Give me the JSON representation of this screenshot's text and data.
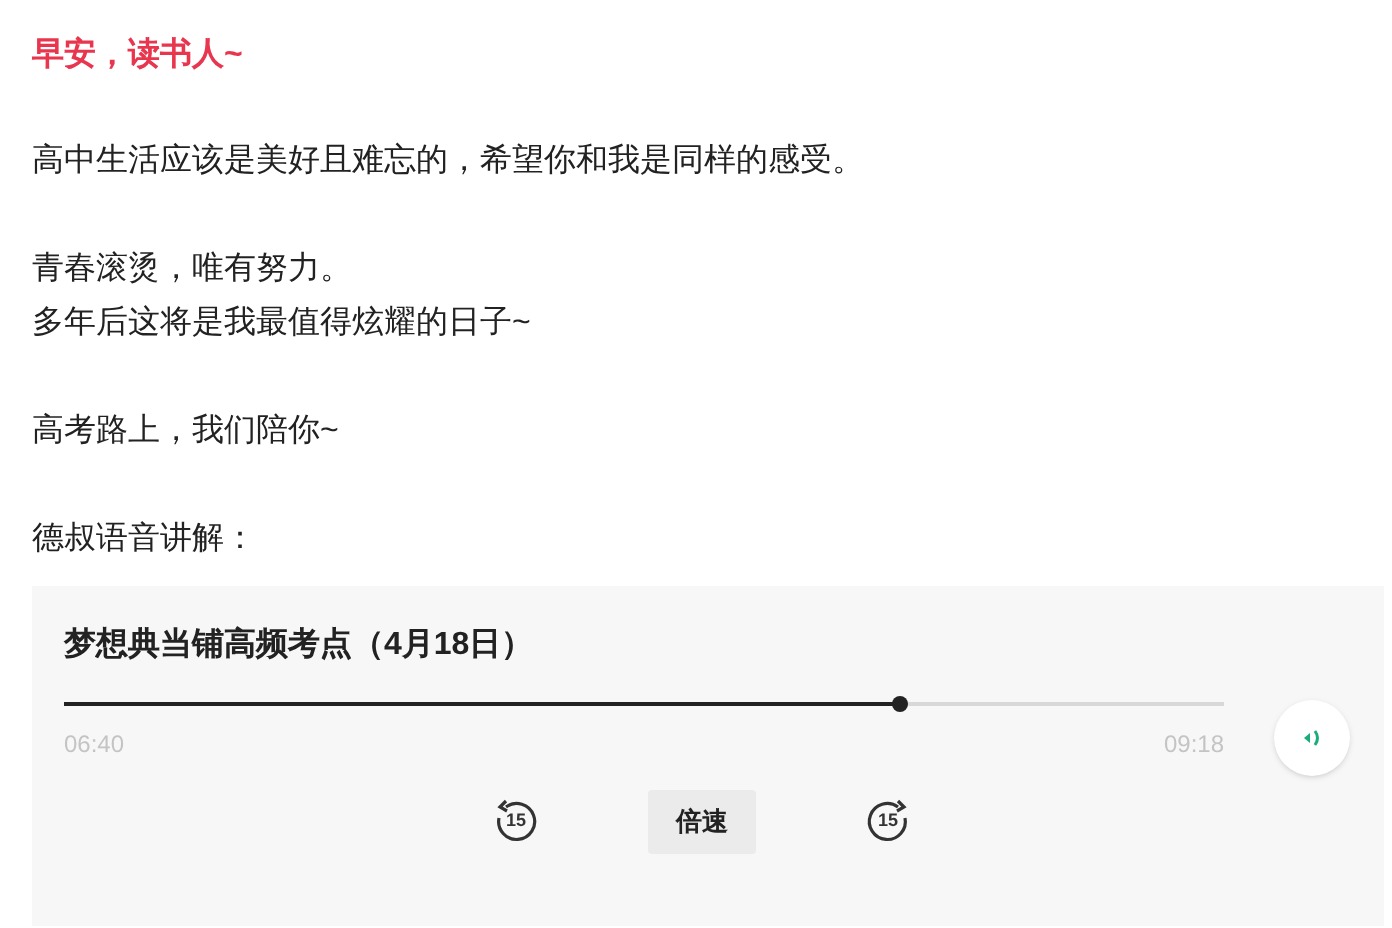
{
  "greeting": "早安，读书人~",
  "paragraphs": [
    [
      "高中生活应该是美好且难忘的，希望你和我是同样的感受。"
    ],
    [
      "青春滚烫，唯有努力。",
      "多年后这将是我最值得炫耀的日子~"
    ],
    [
      "高考路上，我们陪你~"
    ],
    [
      "德叔语音讲解："
    ]
  ],
  "audio": {
    "title": "梦想典当铺高频考点（4月18日）",
    "level": 0.72,
    "elapsed": "06:40",
    "duration": "09:18",
    "rewind": "15",
    "speed": "倍速",
    "forward": "15"
  }
}
